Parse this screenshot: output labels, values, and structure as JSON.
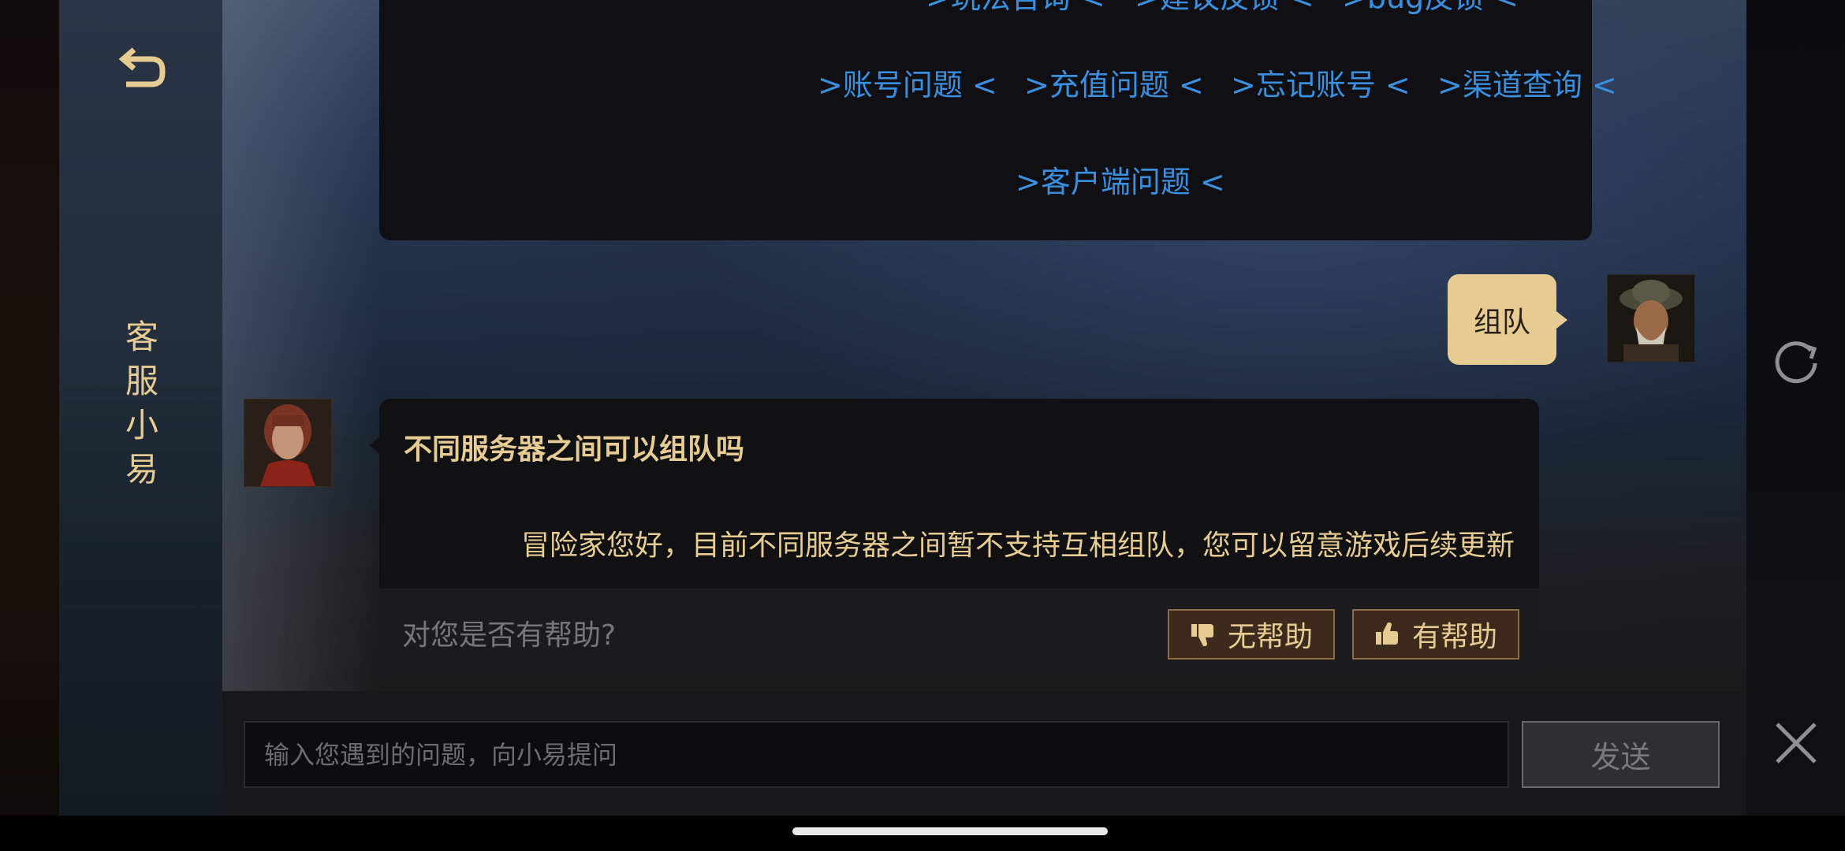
{
  "sidebar": {
    "back_icon": "back-arrow-icon",
    "title_chars": [
      "客",
      "服",
      "小",
      "易"
    ]
  },
  "menu": {
    "links_row0": [
      ">玩法咨询 <",
      ">建议反馈 <",
      ">bug反馈 <"
    ],
    "links_row1": [
      ">账号问题 <",
      ">充值问题 <",
      ">忘记账号 <",
      ">渠道查询 <"
    ],
    "links_row2": [
      ">客户端问题 <"
    ]
  },
  "user_message": "组队",
  "answer": {
    "question": "不同服务器之间可以组队吗",
    "text": "冒险家您好，目前不同服务器之间暂不支持互相组队，您可以留意游戏后续更新",
    "feedback_prompt": "对您是否有帮助?",
    "not_helpful_label": "无帮助",
    "helpful_label": "有帮助"
  },
  "input": {
    "placeholder": "输入您遇到的问题，向小易提问",
    "value": ""
  },
  "send_label": "发送",
  "colors": {
    "accent_gold": "#e6cc93",
    "link_blue": "#3a8fde",
    "bubble_dark": "#111114",
    "button_brown": "#3c2a1d"
  },
  "icons": {
    "back": "back-arrow-icon",
    "refresh": "refresh-icon",
    "close": "close-icon",
    "thumbs_down": "thumbs-down-icon",
    "thumbs_up": "thumbs-up-icon"
  }
}
